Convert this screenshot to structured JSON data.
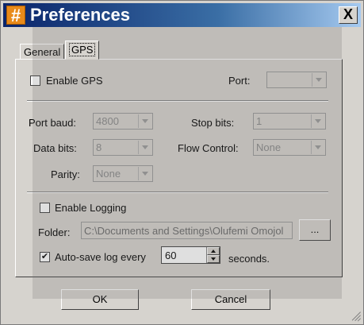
{
  "window": {
    "title": "Preferences",
    "icon_glyph": "#",
    "icon": "hash-app-icon",
    "close_label": "X"
  },
  "tabs": [
    {
      "label": "General",
      "selected": false
    },
    {
      "label": "GPS",
      "selected": true
    }
  ],
  "gps": {
    "enable_label": "Enable GPS",
    "enable_checked": false,
    "port_label": "Port:",
    "port_value": ""
  },
  "serial": {
    "baud_label": "Port baud:",
    "baud_value": "4800",
    "stop_label": "Stop bits:",
    "stop_value": "1",
    "data_label": "Data bits:",
    "data_value": "8",
    "flow_label": "Flow Control:",
    "flow_value": "None",
    "parity_label": "Parity:",
    "parity_value": "None"
  },
  "logging": {
    "enable_label": "Enable Logging",
    "enable_checked": false,
    "folder_label": "Folder:",
    "folder_value": "C:\\Documents and Settings\\Olufemi Omojol",
    "browse_label": "...",
    "autosave_label": "Auto-save log every",
    "autosave_checked": true,
    "autosave_value": "60",
    "seconds_label": "seconds."
  },
  "buttons": {
    "ok": "OK",
    "cancel": "Cancel"
  },
  "colors": {
    "title_bar": "#0a246a",
    "window_face": "#d6d3ce",
    "icon_accent": "#e88a1a"
  }
}
